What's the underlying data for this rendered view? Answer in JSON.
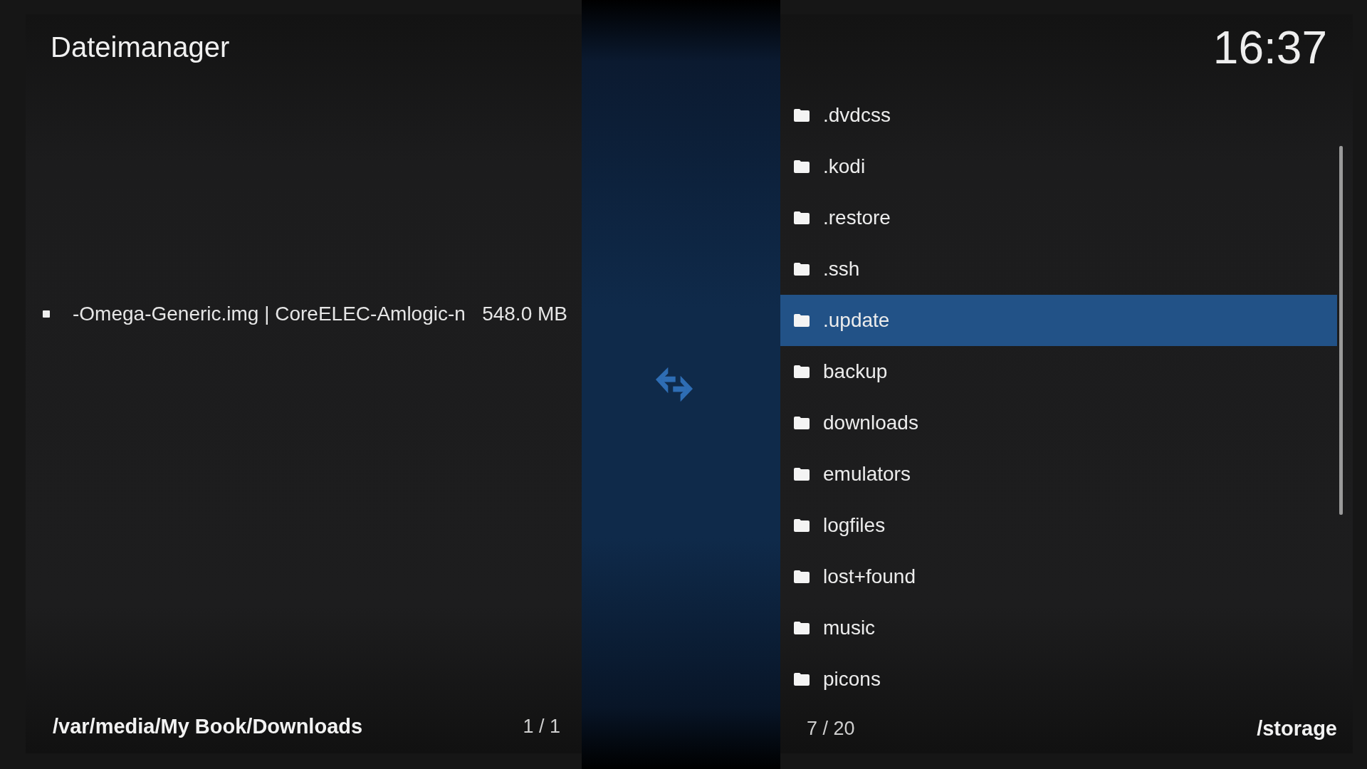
{
  "title": "Dateimanager",
  "clock": "16:37",
  "left_panel": {
    "items": [
      {
        "name": "-Omega-Generic.img | CoreELEC-Amlogic-n",
        "size": "548.0 MB",
        "selected": false
      }
    ],
    "path": "/var/media/My Book/Downloads",
    "count": "1 / 1"
  },
  "right_panel": {
    "items": [
      {
        "name": ".dvdcss",
        "selected": false
      },
      {
        "name": ".kodi",
        "selected": false
      },
      {
        "name": ".restore",
        "selected": false
      },
      {
        "name": ".ssh",
        "selected": false
      },
      {
        "name": ".update",
        "selected": true
      },
      {
        "name": "backup",
        "selected": false
      },
      {
        "name": "downloads",
        "selected": false
      },
      {
        "name": "emulators",
        "selected": false
      },
      {
        "name": "logfiles",
        "selected": false
      },
      {
        "name": "lost+found",
        "selected": false
      },
      {
        "name": "music",
        "selected": false
      },
      {
        "name": "picons",
        "selected": false
      }
    ],
    "count": "7 / 20",
    "path": "/storage"
  }
}
